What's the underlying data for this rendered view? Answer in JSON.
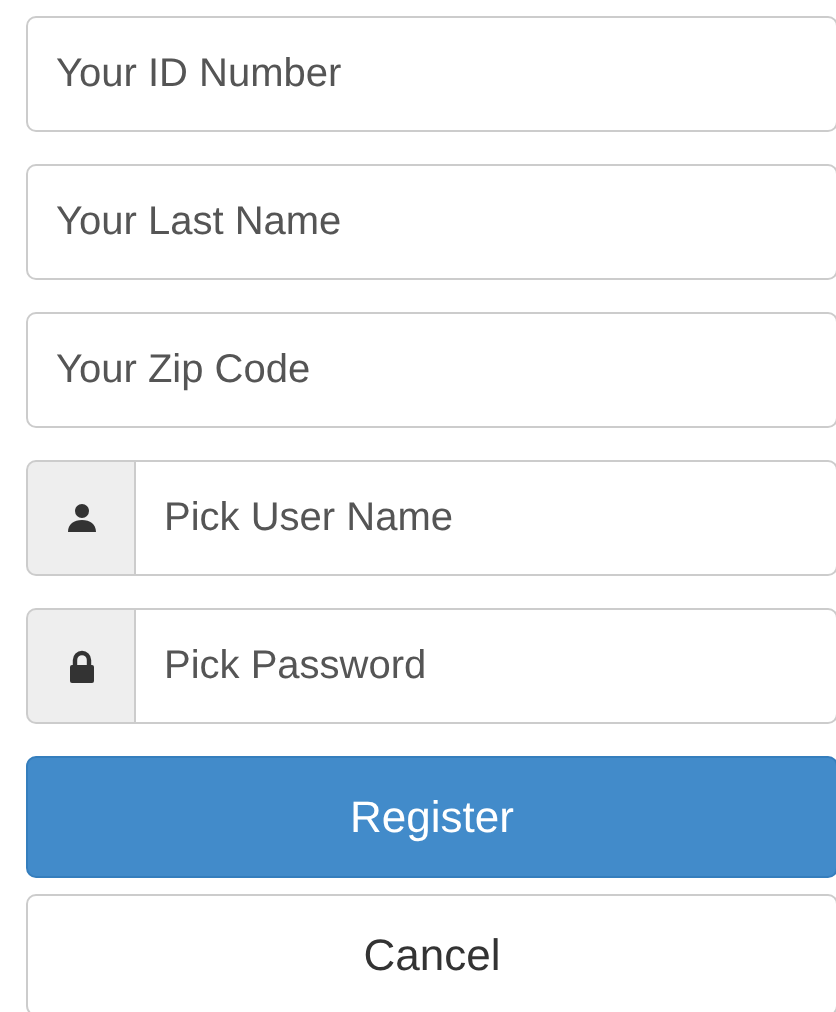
{
  "fields": [
    {
      "kind": "plain",
      "placeholder": "Your ID Number"
    },
    {
      "kind": "plain",
      "placeholder": "Your Last Name"
    },
    {
      "kind": "plain",
      "placeholder": "Your Zip Code"
    },
    {
      "kind": "user",
      "placeholder": "Pick User Name"
    },
    {
      "kind": "lock",
      "placeholder": "Pick Password"
    }
  ],
  "buttons": [
    {
      "kind": "primary",
      "label": "Register"
    },
    {
      "kind": "default",
      "label": "Cancel"
    }
  ]
}
